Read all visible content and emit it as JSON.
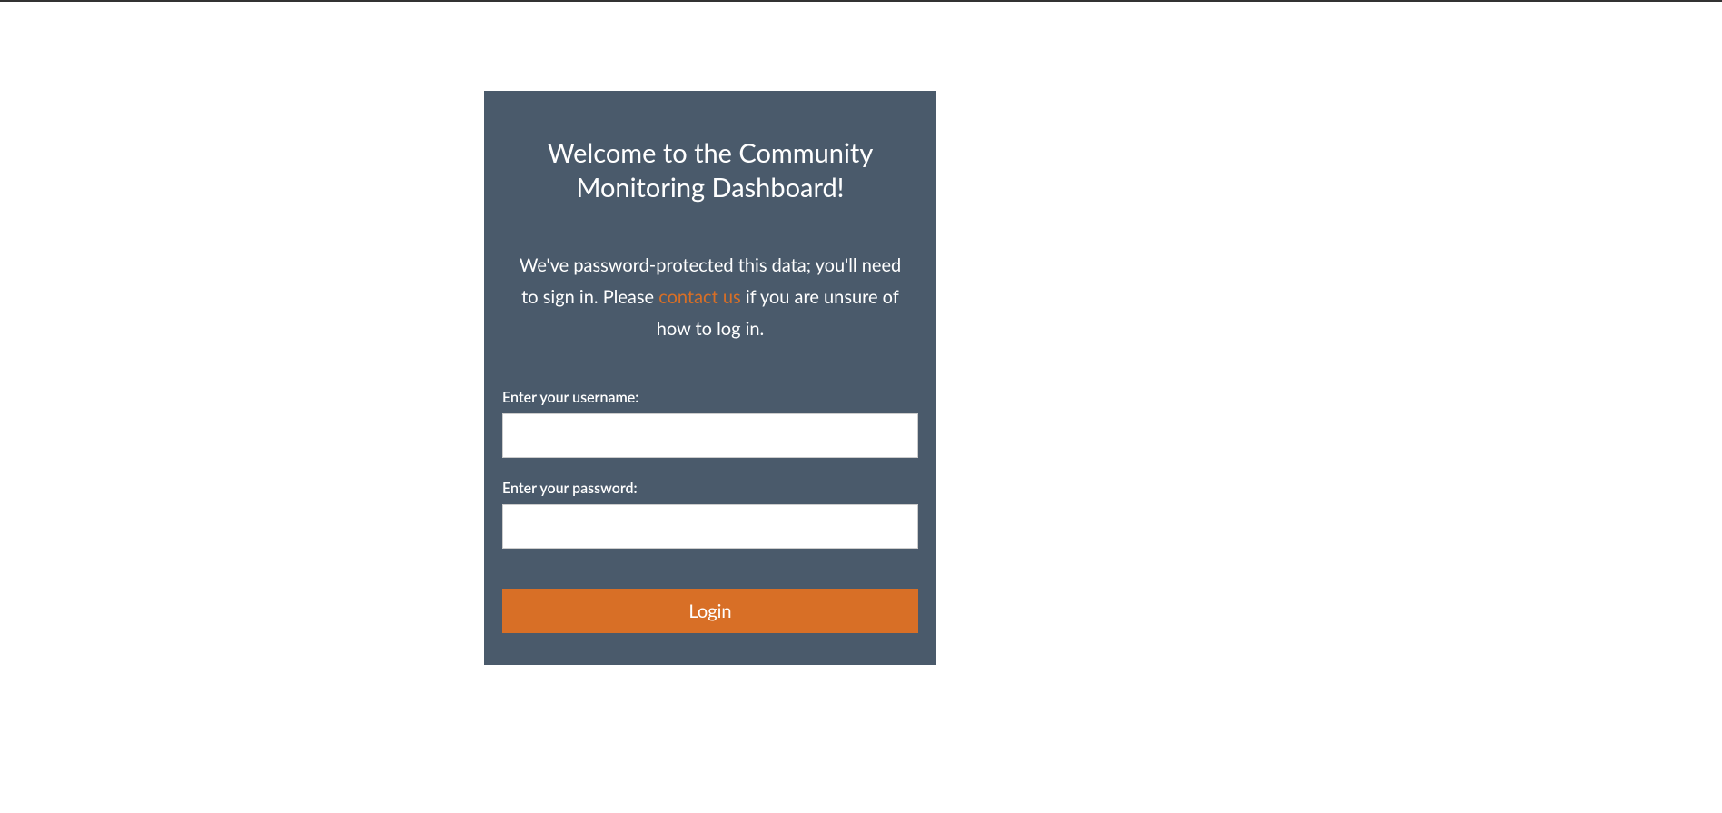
{
  "login": {
    "title": "Welcome to the Community Monitoring Dashboard!",
    "description_part1": "We've password-protected this data; you'll need to sign in. Please ",
    "contact_link_text": "contact us",
    "description_part2": " if you are unsure of how to log in.",
    "username_label": "Enter your username:",
    "password_label": "Enter your password:",
    "button_label": "Login",
    "username_value": "",
    "password_value": ""
  },
  "colors": {
    "panel_bg": "#4a5a6b",
    "accent": "#d86f26",
    "text": "#ffffff"
  }
}
